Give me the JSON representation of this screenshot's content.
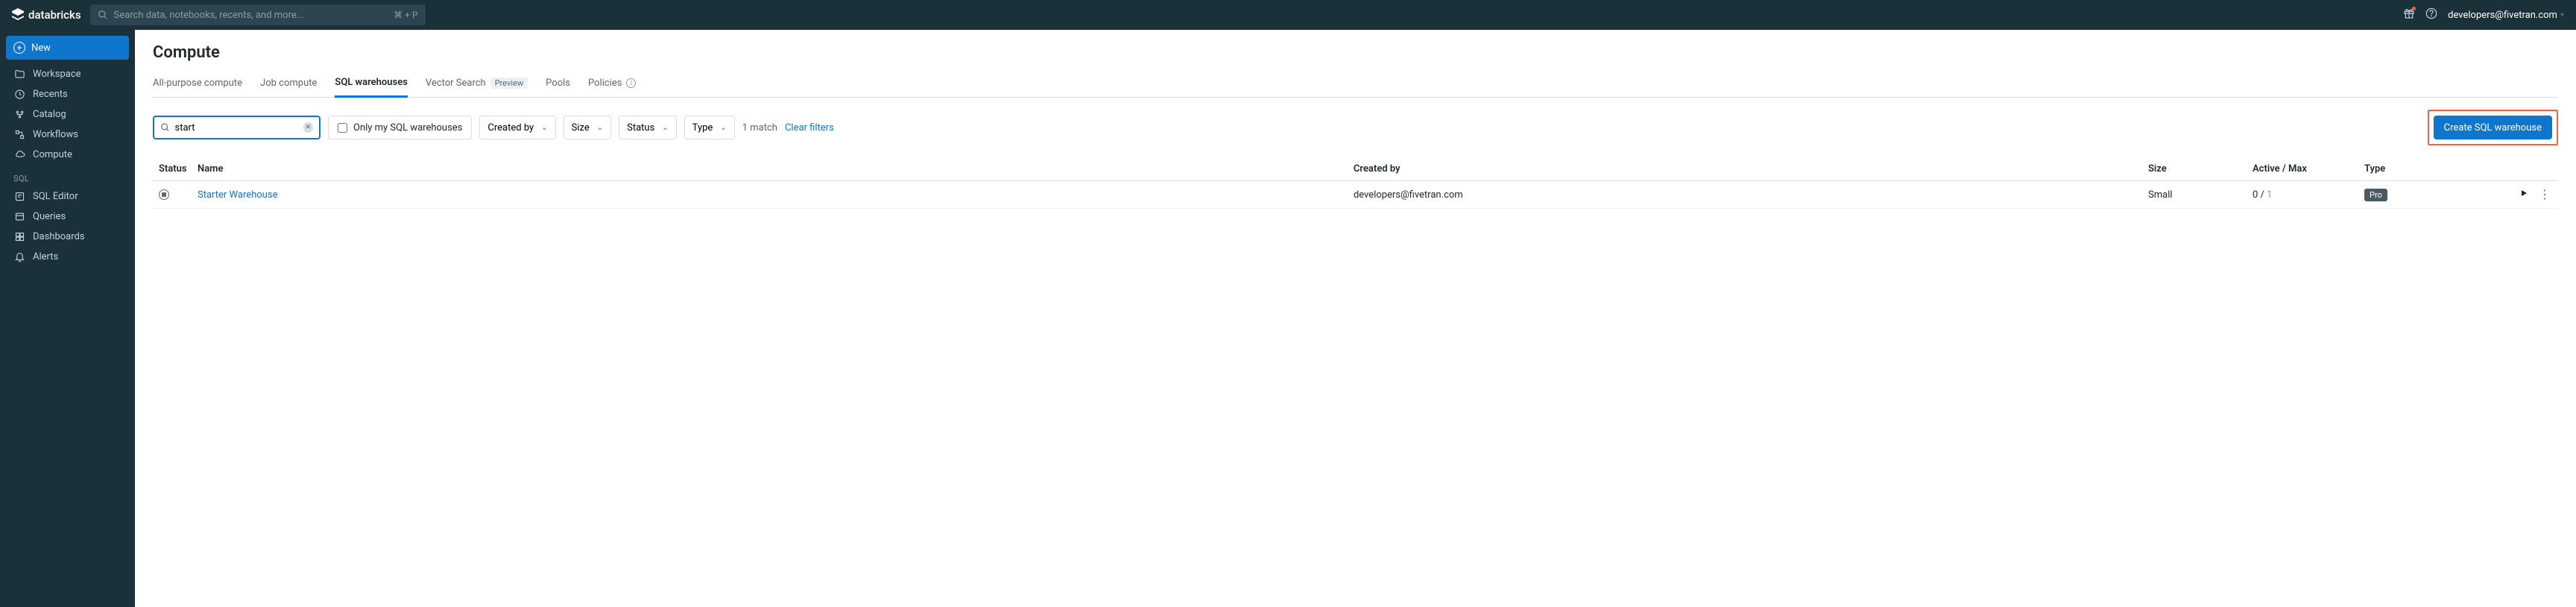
{
  "header": {
    "brand": "databricks",
    "search_placeholder": "Search data, notebooks, recents, and more...",
    "search_shortcut": "⌘ + P",
    "user_email": "developers@fivetran.com"
  },
  "sidebar": {
    "new_label": "New",
    "items_top": [
      {
        "icon": "workspace",
        "label": "Workspace"
      },
      {
        "icon": "recents",
        "label": "Recents"
      },
      {
        "icon": "catalog",
        "label": "Catalog"
      },
      {
        "icon": "workflows",
        "label": "Workflows"
      },
      {
        "icon": "compute",
        "label": "Compute"
      }
    ],
    "section_sql": "SQL",
    "items_sql": [
      {
        "icon": "sql-editor",
        "label": "SQL Editor"
      },
      {
        "icon": "queries",
        "label": "Queries"
      },
      {
        "icon": "dashboards",
        "label": "Dashboards"
      },
      {
        "icon": "alerts",
        "label": "Alerts"
      }
    ]
  },
  "page": {
    "title": "Compute",
    "tabs": [
      {
        "label": "All-purpose compute"
      },
      {
        "label": "Job compute"
      },
      {
        "label": "SQL warehouses",
        "active": true
      },
      {
        "label": "Vector Search",
        "preview": "Preview"
      },
      {
        "label": "Pools"
      },
      {
        "label": "Policies",
        "info": true
      }
    ],
    "filter": {
      "search_value": "start",
      "checkbox_label": "Only my SQL warehouses",
      "dropdowns": [
        "Created by",
        "Size",
        "Status",
        "Type"
      ],
      "match_text": "1 match",
      "clear_label": "Clear filters",
      "create_label": "Create SQL warehouse"
    },
    "table": {
      "headers": {
        "status": "Status",
        "name": "Name",
        "created_by": "Created by",
        "size": "Size",
        "active_max": "Active / Max",
        "type": "Type"
      },
      "rows": [
        {
          "name": "Starter Warehouse",
          "created_by": "developers@fivetran.com",
          "size": "Small",
          "active": "0",
          "max": "1",
          "type": "Pro"
        }
      ]
    }
  }
}
